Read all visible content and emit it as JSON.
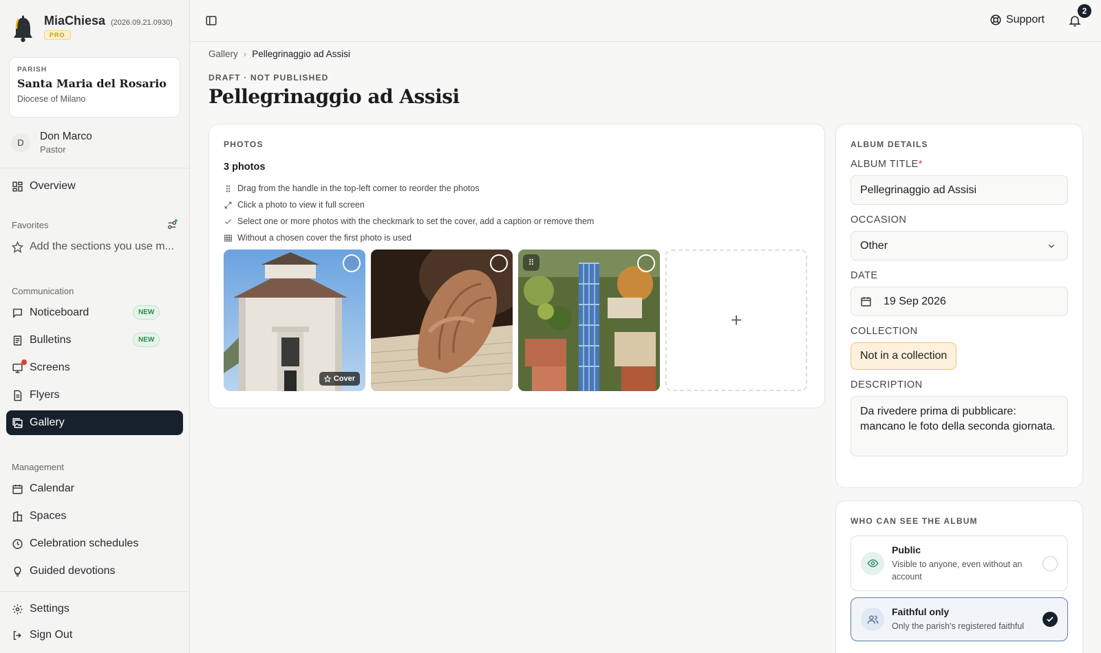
{
  "app": {
    "name": "MiaChiesa",
    "version": "(2026.09.21.0930)",
    "plan_badge": "PRO"
  },
  "parish": {
    "kicker": "PARISH",
    "name": "Santa Maria del Rosario",
    "diocese": "Diocese of Milano"
  },
  "user": {
    "initial": "D",
    "name": "Don Marco",
    "role": "Pastor"
  },
  "nav": {
    "overview": "Overview",
    "favorites_label": "Favorites",
    "favorites_placeholder": "Add the sections you use m...",
    "communication_label": "Communication",
    "noticeboard": "Noticeboard",
    "bulletins": "Bulletins",
    "screens": "Screens",
    "flyers": "Flyers",
    "gallery": "Gallery",
    "new_badge": "NEW",
    "management_label": "Management",
    "calendar": "Calendar",
    "spaces": "Spaces",
    "celebration_schedules": "Celebration schedules",
    "guided_devotions": "Guided devotions",
    "settings": "Settings",
    "sign_out": "Sign Out"
  },
  "topbar": {
    "support": "Support",
    "notification_count": "2"
  },
  "breadcrumb": {
    "root": "Gallery",
    "separator": "›",
    "current": "Pellegrinaggio ad Assisi"
  },
  "page": {
    "status": "DRAFT · NOT PUBLISHED",
    "title": "Pellegrinaggio ad Assisi"
  },
  "photos": {
    "kicker": "PHOTOS",
    "count_label": "3 photos",
    "tips": [
      "Drag from the handle in the top-left corner to reorder the photos",
      "Click a photo to view it full screen",
      "Select one or more photos with the checkmark to set the cover, add a caption or remove them",
      "Without a chosen cover the first photo is used"
    ],
    "cover_label": "Cover",
    "add_symbol": "+",
    "handle_symbol": "⠿"
  },
  "album_details": {
    "kicker": "ALBUM DETAILS",
    "title_label": "ALBUM TITLE",
    "required_mark": "*",
    "title_value": "Pellegrinaggio ad Assisi",
    "occasion_label": "OCCASION",
    "occasion_value": "Other",
    "date_label": "DATE",
    "date_value": "19 Sep 2026",
    "collection_label": "COLLECTION",
    "collection_value": "Not in a collection",
    "description_label": "DESCRIPTION",
    "description_value": "Da rivedere prima di pubblicare: mancano le foto della seconda giornata."
  },
  "visibility": {
    "kicker": "WHO CAN SEE THE ALBUM",
    "options": [
      {
        "title": "Public",
        "subtitle": "Visible to anyone, even without an account",
        "selected": false
      },
      {
        "title": "Faithful only",
        "subtitle": "Only the parish's registered faithful",
        "selected": true
      }
    ]
  },
  "colors": {
    "accent_dark": "#17212c",
    "new_badge": "#2f8a4f",
    "alert_red": "#e53935",
    "collection_pill": "#fdf1dd",
    "pro_badge": "#c79a1c"
  }
}
